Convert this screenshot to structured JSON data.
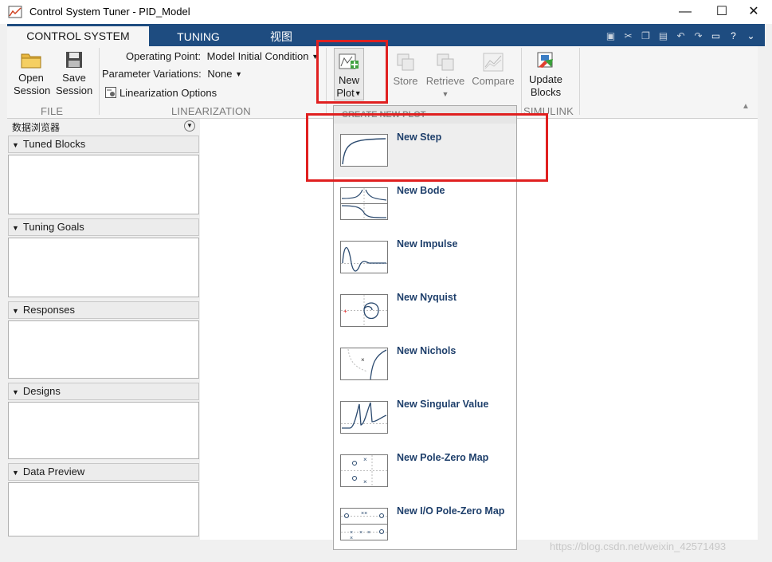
{
  "window": {
    "title": "Control System Tuner - PID_Model",
    "minimize_glyph": "—",
    "maximize_glyph": "☐",
    "close_glyph": "✕"
  },
  "tabs": [
    {
      "label": "CONTROL SYSTEM",
      "active": true
    },
    {
      "label": "TUNING",
      "active": false
    },
    {
      "label": "视图",
      "active": false
    }
  ],
  "quick_access": [
    "save-icon",
    "cut-icon",
    "copy-icon",
    "paste-icon",
    "undo-icon",
    "redo-icon",
    "window-layout-icon",
    "help-icon",
    "expand-icon"
  ],
  "ribbon": {
    "file": {
      "open_line1": "Open",
      "open_line2": "Session",
      "save_line1": "Save",
      "save_line2": "Session",
      "label": "FILE"
    },
    "linearization": {
      "op_label": "Operating Point:",
      "op_value": "Model Initial Condition",
      "pv_label": "Parameter Variations:",
      "pv_value": "None",
      "options_label": "Linearization Options",
      "label": "LINEARIZATION"
    },
    "plot": {
      "new_line1": "New",
      "new_line2": "Plot",
      "store": "Store",
      "retrieve": "Retrieve",
      "compare": "Compare"
    },
    "simulink": {
      "update_line1": "Update",
      "update_line2": "Blocks",
      "label": "SIMULINK"
    }
  },
  "browser": {
    "header": "数据浏览器",
    "sections": [
      "Tuned Blocks",
      "Tuning Goals",
      "Responses",
      "Designs",
      "Data Preview"
    ]
  },
  "menu": {
    "header": "CREATE NEW PLOT",
    "items": [
      {
        "label": "New Step",
        "icon": "step-plot-icon",
        "selected": true
      },
      {
        "label": "New Bode",
        "icon": "bode-plot-icon",
        "selected": false
      },
      {
        "label": "New Impulse",
        "icon": "impulse-plot-icon",
        "selected": false
      },
      {
        "label": "New Nyquist",
        "icon": "nyquist-plot-icon",
        "selected": false
      },
      {
        "label": "New Nichols",
        "icon": "nichols-plot-icon",
        "selected": false
      },
      {
        "label": "New Singular Value",
        "icon": "singular-value-plot-icon",
        "selected": false
      },
      {
        "label": "New Pole-Zero Map",
        "icon": "pole-zero-map-icon",
        "selected": false
      },
      {
        "label": "New I/O Pole-Zero Map",
        "icon": "io-pole-zero-map-icon",
        "selected": false
      }
    ]
  },
  "watermark": "https://blog.csdn.net/weixin_42571493",
  "colors": {
    "tab_bar": "#1e4c80",
    "highlight": "#e02020",
    "menu_label": "#1e3f6b"
  }
}
